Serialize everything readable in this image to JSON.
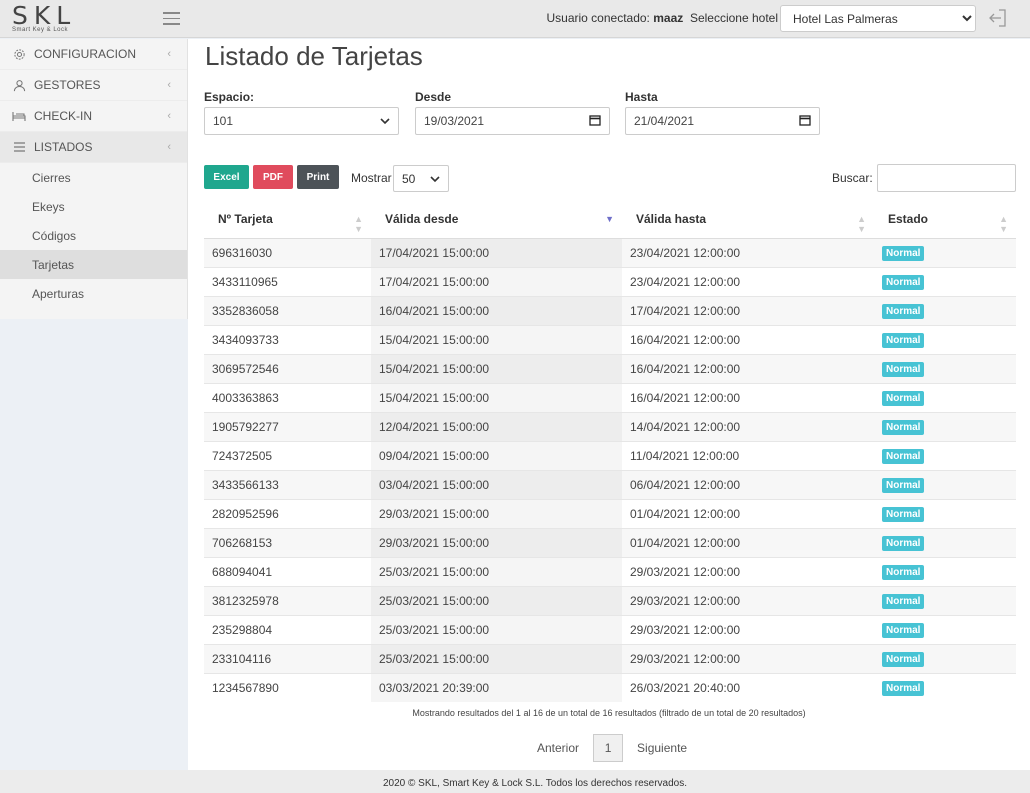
{
  "header": {
    "logo_main": "SKL",
    "logo_sub": "Smart Key & Lock",
    "user_label": "Usuario conectado:",
    "user_name": "maaz",
    "hotel_label": "Seleccione hotel",
    "hotel_value": "Hotel Las Palmeras"
  },
  "sidebar": {
    "items": [
      {
        "label": "CONFIGURACION",
        "icon": "gear-icon"
      },
      {
        "label": "GESTORES",
        "icon": "user-icon"
      },
      {
        "label": "CHECK-IN",
        "icon": "bed-icon"
      },
      {
        "label": "LISTADOS",
        "icon": "list-icon"
      }
    ],
    "subitems": [
      "Cierres",
      "Ekeys",
      "Códigos",
      "Tarjetas",
      "Aperturas"
    ]
  },
  "main": {
    "title": "Listado de Tarjetas",
    "filters": {
      "espacio_label": "Espacio:",
      "espacio_value": "101",
      "desde_label": "Desde",
      "desde_value": "19/03/2021",
      "hasta_label": "Hasta",
      "hasta_value": "21/04/2021"
    },
    "buttons": {
      "excel": "Excel",
      "pdf": "PDF",
      "print": "Print"
    },
    "mostrar_label": "Mostrar",
    "mostrar_value": "50",
    "buscar_label": "Buscar:",
    "table": {
      "headers": [
        "Nº Tarjeta",
        "Válida desde",
        "Válida hasta",
        "Estado"
      ],
      "rows": [
        [
          "696316030",
          "17/04/2021 15:00:00",
          "23/04/2021 12:00:00",
          "Normal"
        ],
        [
          "3433110965",
          "17/04/2021 15:00:00",
          "23/04/2021 12:00:00",
          "Normal"
        ],
        [
          "3352836058",
          "16/04/2021 15:00:00",
          "17/04/2021 12:00:00",
          "Normal"
        ],
        [
          "3434093733",
          "15/04/2021 15:00:00",
          "16/04/2021 12:00:00",
          "Normal"
        ],
        [
          "3069572546",
          "15/04/2021 15:00:00",
          "16/04/2021 12:00:00",
          "Normal"
        ],
        [
          "4003363863",
          "15/04/2021 15:00:00",
          "16/04/2021 12:00:00",
          "Normal"
        ],
        [
          "1905792277",
          "12/04/2021 15:00:00",
          "14/04/2021 12:00:00",
          "Normal"
        ],
        [
          "724372505",
          "09/04/2021 15:00:00",
          "11/04/2021 12:00:00",
          "Normal"
        ],
        [
          "3433566133",
          "03/04/2021 15:00:00",
          "06/04/2021 12:00:00",
          "Normal"
        ],
        [
          "2820952596",
          "29/03/2021 15:00:00",
          "01/04/2021 12:00:00",
          "Normal"
        ],
        [
          "706268153",
          "29/03/2021 15:00:00",
          "01/04/2021 12:00:00",
          "Normal"
        ],
        [
          "688094041",
          "25/03/2021 15:00:00",
          "29/03/2021 12:00:00",
          "Normal"
        ],
        [
          "3812325978",
          "25/03/2021 15:00:00",
          "29/03/2021 12:00:00",
          "Normal"
        ],
        [
          "235298804",
          "25/03/2021 15:00:00",
          "29/03/2021 12:00:00",
          "Normal"
        ],
        [
          "233104116",
          "25/03/2021 15:00:00",
          "29/03/2021 12:00:00",
          "Normal"
        ],
        [
          "1234567890",
          "03/03/2021 20:39:00",
          "26/03/2021 20:40:00",
          "Normal"
        ]
      ]
    },
    "info": "Mostrando resultados del 1 al 16 de un total de 16 resultados (filtrado de un total de 20 resultados)",
    "pagination": {
      "prev": "Anterior",
      "page": "1",
      "next": "Siguiente"
    }
  },
  "footer": {
    "text": "2020 © SKL, Smart Key & Lock S.L. Todos los derechos reservados."
  },
  "colors": {
    "excel": "#1fa78e",
    "pdf": "#e04b5d",
    "print": "#4d5358",
    "badge": "#47c3d4"
  }
}
